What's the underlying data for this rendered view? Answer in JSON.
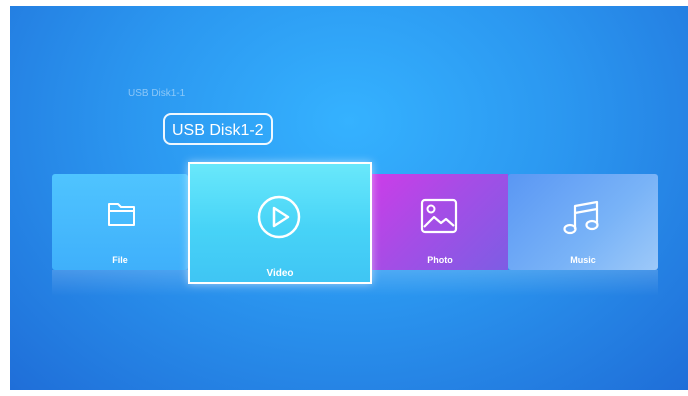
{
  "disks": {
    "previous": "USB Disk1-1",
    "current": "USB Disk1-2"
  },
  "tiles": [
    {
      "label": "File",
      "icon": "folder-icon"
    },
    {
      "label": "Video",
      "icon": "play-circle-icon"
    },
    {
      "label": "Photo",
      "icon": "image-icon"
    },
    {
      "label": "Music",
      "icon": "music-note-icon"
    }
  ],
  "colors": {
    "background": "#2b97f0",
    "file_tile": "#4fc4ff",
    "video_tile": "#55dbf8",
    "photo_tile": "#b548e7",
    "music_tile": "#79b3f7"
  }
}
